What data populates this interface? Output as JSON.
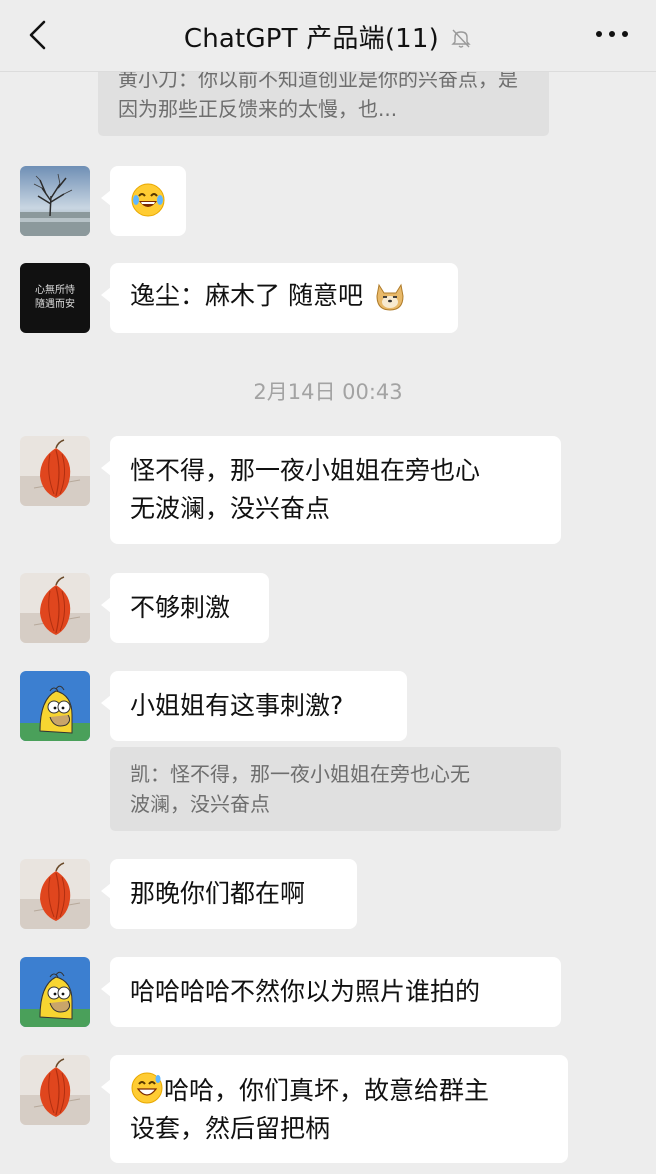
{
  "header": {
    "title": "ChatGPT 产品端(11)",
    "back_icon": "chevron-left-icon",
    "mute_icon": "bell-slash-icon",
    "more_icon": "more-dots-icon"
  },
  "colors": {
    "background": "#ededed",
    "bubble": "#ffffff",
    "quote": "#e0e0e0",
    "timestamp": "#a3a3a3"
  },
  "messages": {
    "top_quote": "黄小刀：你以前不知道创业是你的兴奋点，是因为那些正反馈来的太慢，也...",
    "m1_emoji": "laughing-tears-emoji",
    "m2_text": "逸尘：麻木了 随意吧",
    "m2_emoji": "doge-emoji",
    "time": "2月14日 00:43",
    "m3_line1": "怪不得，那一夜小姐姐在旁也心",
    "m3_line2": "无波澜，没兴奋点",
    "m4_text": "不够刺激",
    "m5_text": "小姐姐有这事刺激?",
    "m5_quote_line1": "凯：怪不得，那一夜小姐姐在旁也心无",
    "m5_quote_line2": "波澜，没兴奋点",
    "m6_text": "那晚你们都在啊",
    "m7_text": "哈哈哈哈不然你以为照片谁拍的",
    "m8_emoji": "grin-sweat-emoji",
    "m8_line1": "哈哈，你们真坏，故意给群主",
    "m8_line2": "设套，然后留把柄"
  },
  "avatars": {
    "tree": "tree-lake-avatar",
    "calligraphy": "calligraphy-avatar",
    "calligraphy_text_line1": "心無所恃",
    "calligraphy_text_line2": "隨遇而安",
    "lantern": "chinese-lantern-plant-avatar",
    "homer": "cartoon-avatar"
  }
}
